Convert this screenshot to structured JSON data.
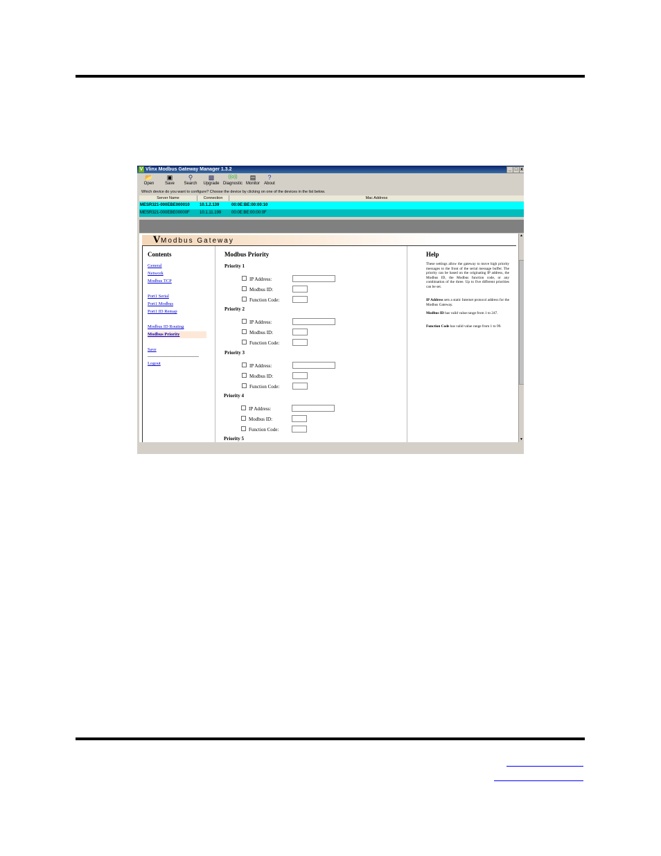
{
  "window": {
    "title": "Vlinx Modbus Gateway Manager 1.3.2",
    "controls": [
      "_",
      "□",
      "x"
    ]
  },
  "toolbar": {
    "items": [
      {
        "label": "Open",
        "icon": "folder-open-icon"
      },
      {
        "label": "Save",
        "icon": "floppy-disk-icon"
      },
      {
        "label": "Search",
        "icon": "magnifier-icon"
      },
      {
        "label": "Upgrade",
        "icon": "upgrade-icon"
      },
      {
        "label": "Diagnostic",
        "icon": "antenna-icon"
      },
      {
        "label": "Monitor",
        "icon": "monitor-icon"
      },
      {
        "label": "About",
        "icon": "question-mark-icon"
      }
    ]
  },
  "device_prompt": "Which device do you want to configure? Choose the device by clicking on one of the devices in the list below.",
  "device_table": {
    "columns": [
      "Server Name",
      "Connection",
      "Mac Address"
    ],
    "rows": [
      {
        "server": "MESR321-000EBE000010",
        "connection": "10.1.2.139",
        "mac": "00:0E:BE:00:00:10"
      },
      {
        "server": "MESR321-000EBE00000F",
        "connection": "10.1.11.199",
        "mac": "00:0E:BE:00:00:0F"
      }
    ],
    "row_colors": [
      "#00ffff",
      "#00bcbc"
    ]
  },
  "banner": {
    "logo": "V",
    "title": "Modbus Gateway"
  },
  "contents": {
    "heading": "Contents",
    "links": [
      "General",
      "Network",
      "Modbus TCP",
      "Port1 Serial",
      "Port1 Modbus",
      "Port1 ID Remap",
      "Modbus ID Routing",
      "Modbus Priority",
      "Save",
      "Logout"
    ]
  },
  "main": {
    "heading": "Modbus Priority",
    "priorities": [
      {
        "title": "Priority 1"
      },
      {
        "title": "Priority 2"
      },
      {
        "title": "Priority 3"
      },
      {
        "title": "Priority 4"
      },
      {
        "title": "Priority 5"
      }
    ],
    "fields": [
      "IP Address:",
      "Modbus ID:",
      "Function Code:"
    ]
  },
  "help": {
    "heading": "Help",
    "intro": "These settings allow the gateway to move high priority messages to the front of the serial message buffer. The priority can be based on the originating IP address, the Modbus ID, the Modbus function code, or any combination of the three. Up to five different priorities can be set.",
    "ip_term": "IP Address",
    "ip_text": " sets a static Internet protocol address for the Modbus Gateway.",
    "id_term": "Modbus ID",
    "id_text": " has valid value range from 1 to 247.",
    "fc_term": "Function Code",
    "fc_text": " has valid value range from 1 to 99."
  },
  "accent_colors": {
    "selected_row": "#00ffff",
    "selected_nav": "#fde8d8",
    "link": "#0000cc"
  }
}
